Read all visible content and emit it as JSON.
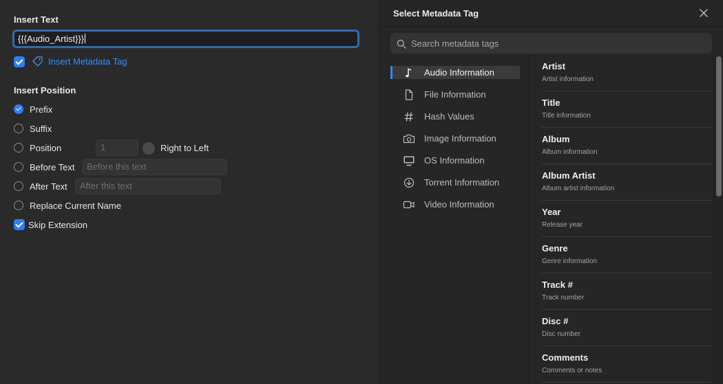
{
  "insert_text": {
    "title": "Insert Text",
    "value": "{{{Audio_Artist}}}",
    "metadata_checkbox_checked": true,
    "metadata_link_label": "Insert Metadata Tag"
  },
  "insert_position": {
    "title": "Insert Position",
    "options": [
      {
        "label": "Prefix",
        "selected": true
      },
      {
        "label": "Suffix",
        "selected": false
      },
      {
        "label": "Position",
        "selected": false
      },
      {
        "label": "Before Text",
        "selected": false
      },
      {
        "label": "After Text",
        "selected": false
      },
      {
        "label": "Replace Current Name",
        "selected": false
      }
    ],
    "position_placeholder": "1",
    "right_to_left_label": "Right to Left",
    "before_text_placeholder": "Before this text",
    "after_text_placeholder": "After this text",
    "skip_extension_label": "Skip Extension",
    "skip_extension_checked": true
  },
  "metadata_panel": {
    "title": "Select Metadata Tag",
    "search_placeholder": "Search metadata tags",
    "categories": [
      {
        "label": "Audio Information",
        "icon": "music-note-icon",
        "active": true
      },
      {
        "label": "File Information",
        "icon": "file-icon",
        "active": false
      },
      {
        "label": "Hash Values",
        "icon": "hash-icon",
        "active": false
      },
      {
        "label": "Image Information",
        "icon": "camera-icon",
        "active": false
      },
      {
        "label": "OS Information",
        "icon": "monitor-icon",
        "active": false
      },
      {
        "label": "Torrent Information",
        "icon": "download-icon",
        "active": false
      },
      {
        "label": "Video Information",
        "icon": "video-camera-icon",
        "active": false
      }
    ],
    "tags": [
      {
        "name": "Artist",
        "desc": "Artist information"
      },
      {
        "name": "Title",
        "desc": "Title information"
      },
      {
        "name": "Album",
        "desc": "Album information"
      },
      {
        "name": "Album Artist",
        "desc": "Album artist information"
      },
      {
        "name": "Year",
        "desc": "Release year"
      },
      {
        "name": "Genre",
        "desc": "Genre information"
      },
      {
        "name": "Track #",
        "desc": "Track number"
      },
      {
        "name": "Disc #",
        "desc": "Disc number"
      },
      {
        "name": "Comments",
        "desc": "Comments or notes"
      }
    ]
  },
  "colors": {
    "accent": "#2f7cf6",
    "link": "#3b8cf6",
    "background": "#2a2a2b"
  }
}
